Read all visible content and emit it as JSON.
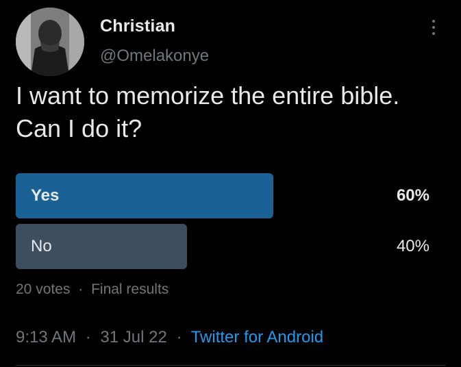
{
  "user": {
    "display_name": "Christian",
    "handle": "@Omelakonye"
  },
  "tweet": {
    "text": "I want to memorize the entire bible. Can I do it?"
  },
  "poll": {
    "options": [
      {
        "label": "Yes",
        "percent_text": "60%",
        "fraction": 0.6,
        "bar_color": "#1a6296",
        "winner": true
      },
      {
        "label": "No",
        "percent_text": "40%",
        "fraction": 0.4,
        "bar_color": "#3d4f5f",
        "winner": false
      }
    ],
    "votes": "20 votes",
    "separator": "·",
    "status": "Final results"
  },
  "meta": {
    "time": "9:13 AM",
    "separator": "·",
    "date": "31 Jul 22",
    "source": "Twitter for Android"
  },
  "colors": {
    "background": "#000000",
    "primary_text": "#e7e9ea",
    "secondary_text": "#71767b",
    "link": "#1d9bf0"
  },
  "icons": {
    "more": "more-vertical-icon"
  }
}
